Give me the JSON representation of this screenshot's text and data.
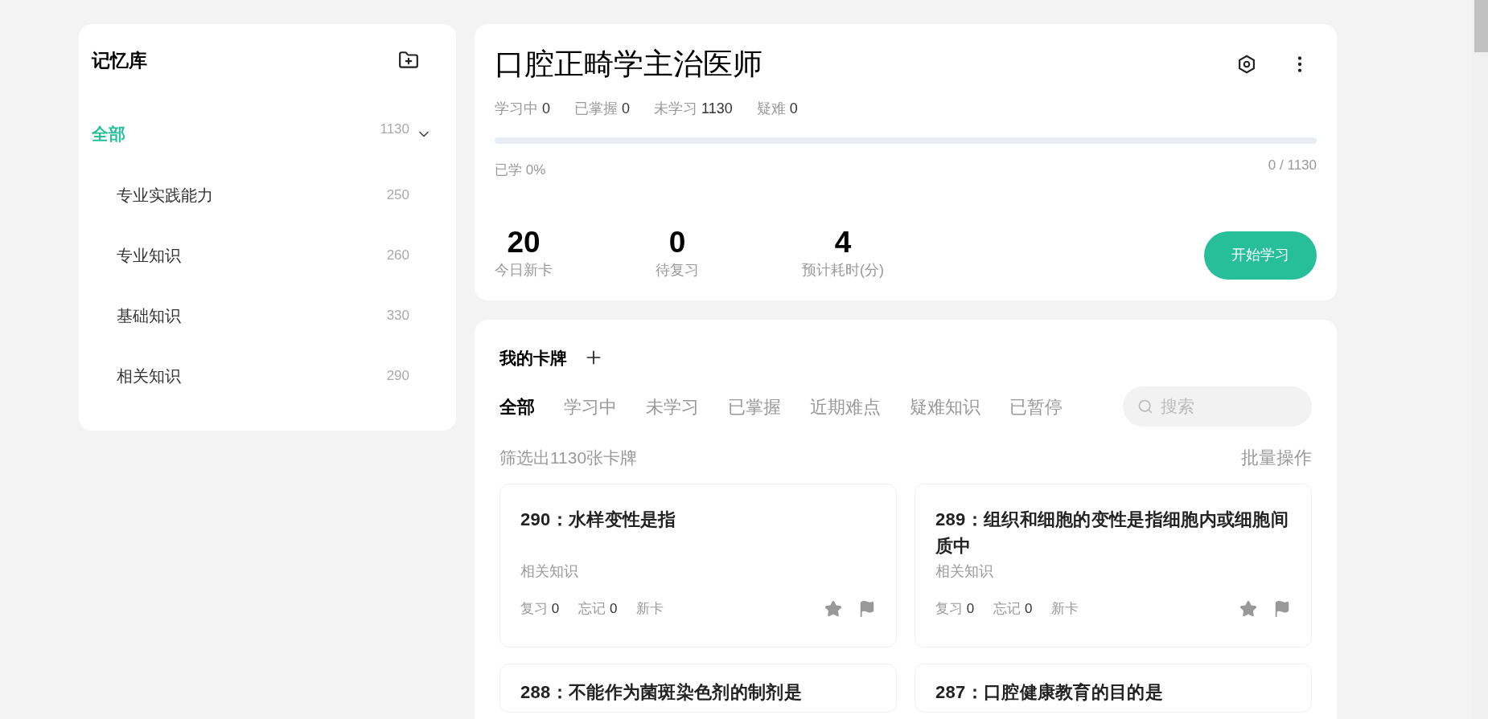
{
  "sidebar": {
    "title": "记忆库",
    "root": {
      "label": "全部",
      "count": "1130",
      "selected": true,
      "expanded": true,
      "children": [
        {
          "label": "专业实践能力",
          "count": "250",
          "selected": false
        },
        {
          "label": "专业知识",
          "count": "260",
          "selected": false
        },
        {
          "label": "基础知识",
          "count": "330",
          "selected": false
        },
        {
          "label": "相关知识",
          "count": "290",
          "selected": false
        }
      ]
    }
  },
  "deck": {
    "title": "口腔正畸学主治医师",
    "stats": [
      {
        "label": "学习中",
        "value": "0"
      },
      {
        "label": "已掌握",
        "value": "0"
      },
      {
        "label": "未学习",
        "value": "1130"
      },
      {
        "label": "疑难",
        "value": "0"
      }
    ],
    "progress": {
      "level": 0,
      "caption": "已学 0%",
      "reading": "0 / 1130"
    },
    "today": [
      {
        "value": "20",
        "label": "今日新卡"
      },
      {
        "value": "0",
        "label": "待复习"
      },
      {
        "value": "4",
        "label": "预计耗时(分)"
      }
    ],
    "start_button": "开始学习"
  },
  "cards_panel": {
    "title": "我的卡牌",
    "tabs": [
      {
        "label": "全部",
        "selected": true
      },
      {
        "label": "学习中",
        "selected": false
      },
      {
        "label": "未学习",
        "selected": false
      },
      {
        "label": "已掌握",
        "selected": false
      },
      {
        "label": "近期难点",
        "selected": false
      },
      {
        "label": "疑难知识",
        "selected": false
      },
      {
        "label": "已暂停",
        "selected": false
      }
    ],
    "search": {
      "placeholder": "搜索"
    },
    "filter_summary": "筛选出1130张卡牌",
    "bulk_action": "批量操作",
    "cards": [
      {
        "title": "290：水样变性是指",
        "category": "相关知识",
        "review_label": "复习",
        "review": "0",
        "forget_label": "忘记",
        "forget": "0",
        "status": "新卡"
      },
      {
        "title": "289：组织和细胞的变性是指细胞内或细胞间质中",
        "category": "相关知识",
        "review_label": "复习",
        "review": "0",
        "forget_label": "忘记",
        "forget": "0",
        "status": "新卡"
      },
      {
        "title": "288：不能作为菌斑染色剂的制剂是"
      },
      {
        "title": "287：口腔健康教育的目的是"
      }
    ]
  }
}
